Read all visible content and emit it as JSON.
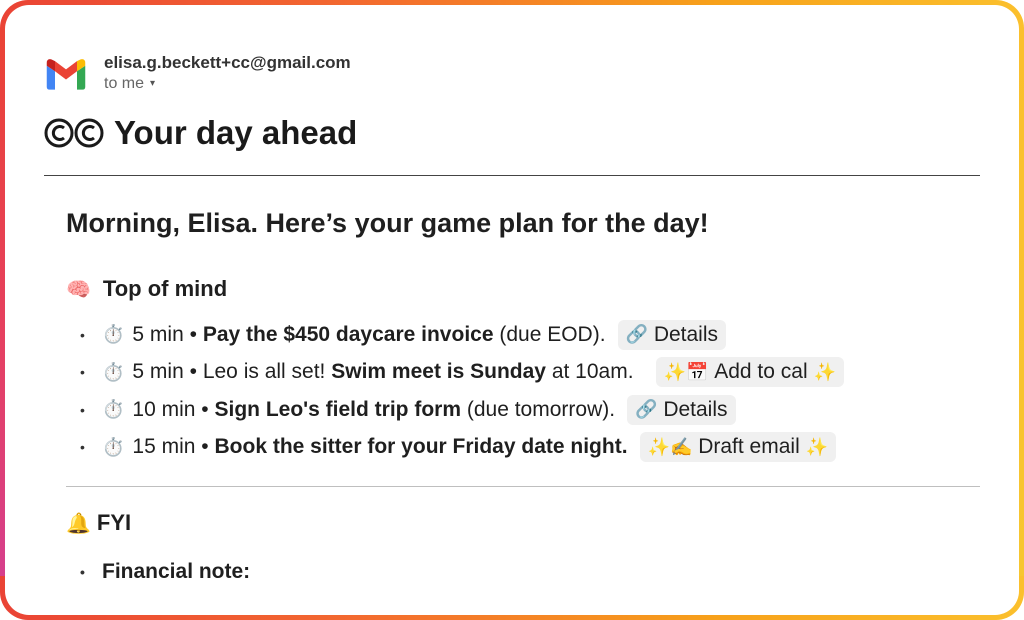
{
  "sender": {
    "email": "elisa.g.beckett+cc@gmail.com",
    "to_label": "to me"
  },
  "subject": "Your day ahead",
  "greeting": "Morning, Elisa. Here’s your game plan for the day!",
  "sections": {
    "top_of_mind": {
      "emoji": "🧠",
      "title": "Top of mind"
    },
    "fyi": {
      "emoji": "🔔",
      "title": "FYI"
    }
  },
  "tasks": [
    {
      "duration": "5 min",
      "pre": "",
      "bold": "Pay the $450 daycare invoice",
      "post": " (due EOD).",
      "chip": {
        "emoji_left": "🔗",
        "label": "Details",
        "emoji_right": ""
      }
    },
    {
      "duration": "5 min",
      "pre": "Leo is all set! ",
      "bold": "Swim meet is Sunday",
      "post": " at 10am.",
      "chip": {
        "emoji_left": "✨📅",
        "label": "Add to cal",
        "emoji_right": "✨"
      }
    },
    {
      "duration": "10 min",
      "pre": "",
      "bold": "Sign Leo's field trip form",
      "post": " (due tomorrow).",
      "chip": {
        "emoji_left": "🔗",
        "label": "Details",
        "emoji_right": ""
      }
    },
    {
      "duration": "15 min",
      "pre": "",
      "bold": "Book the sitter for your Friday date night.",
      "post": "",
      "chip": {
        "emoji_left": "✨✍️",
        "label": "Draft email",
        "emoji_right": "✨"
      }
    }
  ],
  "fyi_items": [
    {
      "label": "Financial note:"
    }
  ],
  "glyphs": {
    "timer": "⏱️",
    "bullet": "•",
    "dot": "•",
    "caret": "▾"
  },
  "icons": {
    "gmail": "gmail-logo-icon",
    "cc": "cc-logo-icon"
  },
  "colors": {
    "gmail_red": "#ea4335",
    "gmail_blue": "#4285f4",
    "gmail_green": "#34a853",
    "gmail_yellow": "#fbbc04",
    "frame_orange": "#f7a11a",
    "chip_bg": "#f0f0f0"
  }
}
